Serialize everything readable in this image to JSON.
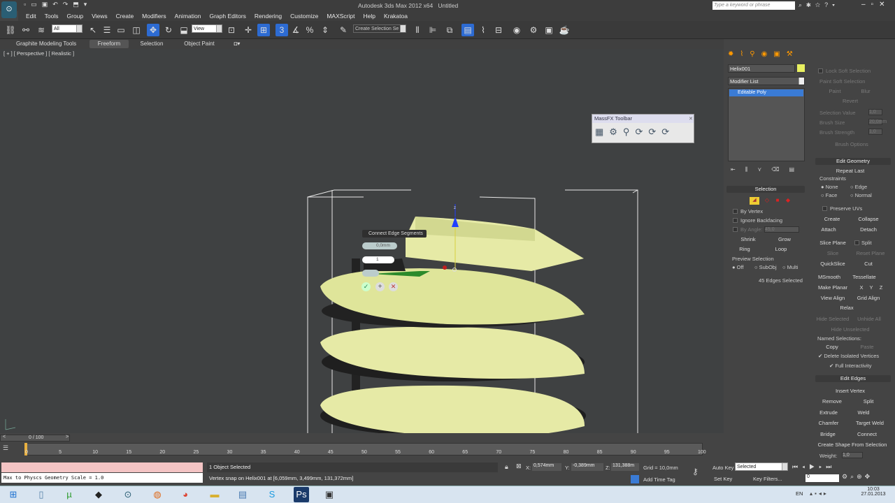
{
  "window": {
    "title": "Autodesk 3ds Max 2012 x64",
    "doc": "Untitled",
    "search_placeholder": "Type a keyword or phrase"
  },
  "menu": [
    "Edit",
    "Tools",
    "Group",
    "Views",
    "Create",
    "Modifiers",
    "Animation",
    "Graph Editors",
    "Rendering",
    "Customize",
    "MAXScript",
    "Help",
    "Krakatoa"
  ],
  "toolbar": {
    "filter": "All",
    "coord": "View",
    "named_sel": "Create Selection Se"
  },
  "ribbon": {
    "tabs": [
      "Graphite Modeling Tools",
      "Freeform",
      "Selection",
      "Object Paint"
    ],
    "active": "Freeform"
  },
  "viewport": {
    "label": "[ + ] [ Perspective ] [ Realistic ]"
  },
  "caddy": {
    "title": "Connect Edge Segments",
    "slide": "0,0mm",
    "segments": "1"
  },
  "massfx": {
    "title": "MassFX Toolbar"
  },
  "cmd": {
    "object_name": "Helix001",
    "object_color": "#e8f060",
    "modifier_list": "Modifier List",
    "stack_item": "Editable Poly"
  },
  "selection": {
    "title": "Selection",
    "by_vertex": "By Vertex",
    "ignore_backfacing": "Ignore Backfacing",
    "by_angle": "By Angle:",
    "angle": "45,0",
    "shrink": "Shrink",
    "grow": "Grow",
    "ring": "Ring",
    "loop": "Loop",
    "preview": "Preview Selection",
    "preview_opts": [
      "Off",
      "SubObj",
      "Multi"
    ],
    "status": "45 Edges Selected"
  },
  "soft": {
    "lock": "Lock Soft Selection",
    "paint_title": "Paint Soft Selection",
    "paint": "Paint",
    "blur": "Blur",
    "revert": "Revert",
    "sel_value": "Selection Value",
    "sel_value_v": "1,0",
    "brush_size": "Brush Size",
    "brush_size_v": "20,0mm",
    "brush_strength": "Brush Strength",
    "brush_strength_v": "1,0",
    "brush_options": "Brush Options"
  },
  "editgeo": {
    "title": "Edit Geometry",
    "repeat_last": "Repeat Last",
    "constraints": "Constraints",
    "none": "None",
    "edge": "Edge",
    "face": "Face",
    "normal": "Normal",
    "preserve": "Preserve UVs",
    "create": "Create",
    "collapse": "Collapse",
    "attach": "Attach",
    "detach": "Detach",
    "slice_plane": "Slice Plane",
    "split": "Split",
    "slice": "Slice",
    "reset_plane": "Reset Plane",
    "quickslice": "QuickSlice",
    "cut": "Cut",
    "msmooth": "MSmooth",
    "tessellate": "Tessellate",
    "make_planar": "Make Planar",
    "x": "X",
    "y": "Y",
    "z": "Z",
    "view_align": "View Align",
    "grid_align": "Grid Align",
    "relax": "Relax",
    "hide_selected": "Hide Selected",
    "unhide_all": "Unhide All",
    "hide_unselected": "Hide Unselected",
    "named": "Named Selections:",
    "copy": "Copy",
    "paste": "Paste",
    "del_iso": "Delete Isolated Vertices",
    "full_inter": "Full Interactivity"
  },
  "editedges": {
    "title": "Edit Edges",
    "insert_vertex": "Insert Vertex",
    "remove": "Remove",
    "split": "Split",
    "extrude": "Extrude",
    "weld": "Weld",
    "chamfer": "Chamfer",
    "target_weld": "Target Weld",
    "bridge": "Bridge",
    "connect": "Connect",
    "create_shape": "Create Shape From Selection",
    "weight": "Weight:",
    "weight_v": "1,0"
  },
  "timeline": {
    "frame": "0 / 100",
    "ticks": [
      "0",
      "5",
      "10",
      "15",
      "20",
      "25",
      "30",
      "35",
      "40",
      "45",
      "50",
      "55",
      "60",
      "65",
      "70",
      "75",
      "80",
      "85",
      "90",
      "95",
      "100"
    ]
  },
  "status": {
    "listener": "Max to Physcs Geometry Scale = 1.0",
    "selected": "1 Object Selected",
    "prompt": "Vertex snap on Helix001 at [6,059mm, 3,499mm, 131,372mm]",
    "x_label": "X:",
    "x": "0,574mm",
    "y_label": "Y:",
    "y": "-0,389mm",
    "z_label": "Z:",
    "z": "131,388m",
    "grid": "Grid = 10,0mm",
    "add_tag": "Add Time Tag",
    "auto_key": "Auto Key",
    "set_key": "Set Key",
    "key_mode": "Selected",
    "key_filters": "Key Filters...",
    "frame_field": "0"
  },
  "taskbar": {
    "lang": "EN",
    "time": "10:03",
    "date": "27.01.2013"
  }
}
